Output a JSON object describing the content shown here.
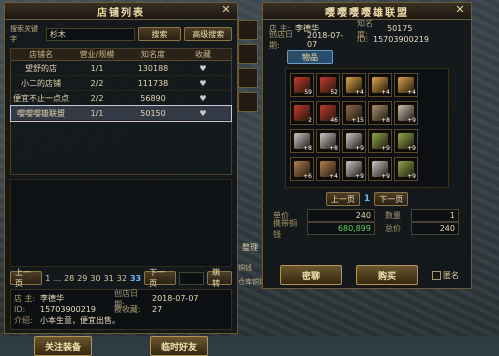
{
  "shop_list": {
    "title": "店铺列表",
    "search_label": "搜索关键字",
    "search_value": "杉木",
    "search_button": "搜索",
    "filter_dropdown": "高级搜索",
    "columns": [
      "店铺名",
      "营业/规模",
      "知名度",
      "收藏"
    ],
    "rows": [
      {
        "name": "望舒的店",
        "scale": "1/1",
        "fame": "130188"
      },
      {
        "name": "小二的店铺",
        "scale": "2/2",
        "fame": "111738"
      },
      {
        "name": "便宜不止一点点",
        "scale": "2/2",
        "fame": "56890"
      },
      {
        "name": "嘤嘤嘤雄联盟",
        "scale": "1/1",
        "fame": "50150"
      }
    ],
    "pagination": {
      "prev": "上一页",
      "pages": [
        "1",
        "...",
        "28",
        "29",
        "30",
        "31",
        "32",
        "33"
      ],
      "current": "33",
      "next": "下一页",
      "jump": "跳转"
    },
    "owner_info": {
      "owner_label": "店 主:",
      "owner_value": "李德华",
      "created_label": "创店日期:",
      "created_value": "2018-07-07",
      "id_label": "ID:",
      "id_value": "15703900219",
      "favorites_label": "被收藏:",
      "favorites_value": "27",
      "intro_label": "介绍:",
      "intro_value": "小本生意，便宜出售。"
    },
    "follow_button": "关注装备",
    "temp_friend_button": "临时好友"
  },
  "shop_detail": {
    "title": "嘤嘤嘤嘤雄联盟",
    "owner_label": "店 主:",
    "owner_value": "李德华",
    "fame_label": "知名度:",
    "fame_value": "50175",
    "created_label": "创店日期:",
    "created_value": "2018-07-07",
    "id_label": "ID:",
    "id_value": "15703900219",
    "tab_items": "物品",
    "items": [
      {
        "color": "#c23a2a",
        "qty": "59"
      },
      {
        "color": "#c23a2a",
        "qty": "52"
      },
      {
        "color": "#d9a54a",
        "qty": "+4"
      },
      {
        "color": "#d9a54a",
        "qty": "+4"
      },
      {
        "color": "#d9a54a",
        "qty": "+4"
      },
      {
        "color": "#c23a2a",
        "qty": "2"
      },
      {
        "color": "#c23a2a",
        "qty": "46"
      },
      {
        "color": "#8b6a4a",
        "qty": "+15"
      },
      {
        "color": "#a89070",
        "qty": "+8"
      },
      {
        "color": "#c8c0b0",
        "qty": "+9"
      },
      {
        "color": "#c8c8c8",
        "qty": "+8"
      },
      {
        "color": "#c8c8c8",
        "qty": "+8"
      },
      {
        "color": "#c8c8c8",
        "qty": "+9"
      },
      {
        "color": "#8fa84a",
        "qty": "+9"
      },
      {
        "color": "#8fa84a",
        "qty": "+9"
      },
      {
        "color": "#b08050",
        "qty": "+6"
      },
      {
        "color": "#b08050",
        "qty": "+4"
      },
      {
        "color": "#c8c8c8",
        "qty": "+9"
      },
      {
        "color": "#c8c8c8",
        "qty": "+9"
      },
      {
        "color": "#8fa84a",
        "qty": "+9"
      }
    ],
    "prev": "上一页",
    "page": "1",
    "next": "下一页",
    "price_label": "单价",
    "price_value": "240",
    "quantity_label": "数量",
    "quantity_value": "1",
    "owned_label": "携带铜钱",
    "owned_value": "680,899",
    "total_label": "总价",
    "total_value": "240",
    "chat_button": "密聊",
    "buy_button": "购买",
    "anon_label": "匿名"
  },
  "middle_strip": {
    "organize_label": "整理",
    "copper_label": "铜钱",
    "warehouse_label": "仓库铜钱"
  }
}
